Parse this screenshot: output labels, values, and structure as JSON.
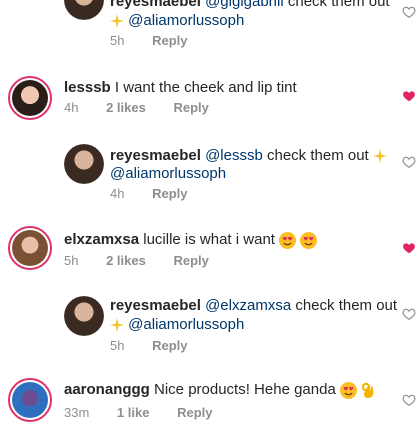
{
  "comments": [
    {
      "username": "reyesmaebel",
      "mention": "@gigigabriii",
      "text": "check them out",
      "emoji_after_text": "sparkles",
      "line2_mention": "@aliamorlussoph",
      "time": "5h",
      "likes": "",
      "reply": "Reply",
      "liked": false
    },
    {
      "username": "lesssb",
      "text": "I want the cheek and lip tint",
      "time": "4h",
      "likes": "2 likes",
      "reply": "Reply",
      "liked": true
    },
    {
      "username": "reyesmaebel",
      "mention": "@lesssb",
      "text": "check them out",
      "emoji_after_text": "sparkles",
      "line2_mention": "@aliamorlussoph",
      "time": "4h",
      "likes": "",
      "reply": "Reply",
      "liked": false
    },
    {
      "username": "elxzamxsa",
      "text": "lucille is what i want",
      "emojis": [
        "heart-eyes",
        "heart-eyes"
      ],
      "time": "5h",
      "likes": "2 likes",
      "reply": "Reply",
      "liked": true
    },
    {
      "username": "reyesmaebel",
      "mention": "@elxzamxsa",
      "text": "check them out",
      "line2_mention": "@aliamorlussoph",
      "line2_emoji_before": "sparkles",
      "time": "5h",
      "likes": "",
      "reply": "Reply",
      "liked": false
    },
    {
      "username": "aaronanggg",
      "text": "Nice products! Hehe ganda",
      "emojis": [
        "heart-eyes",
        "ok-hand"
      ],
      "time": "33m",
      "likes": "1 like",
      "reply": "Reply",
      "liked": false
    }
  ],
  "colors": {
    "liked_heart": "#e0245e",
    "mention": "#00376b",
    "meta": "#8e8e8e",
    "story_ring": "#e1306c"
  }
}
